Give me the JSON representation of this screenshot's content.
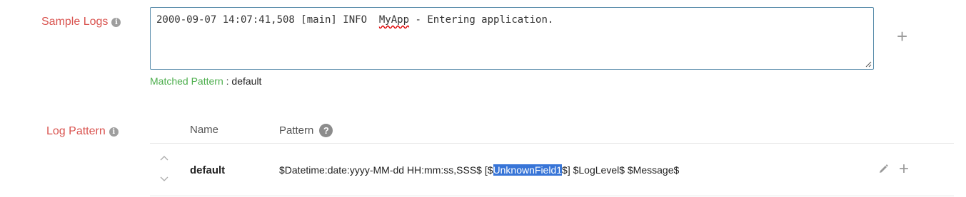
{
  "sample_logs": {
    "label": "Sample Logs",
    "log_prefix": "2000-09-07 14:07:41,508 [main] INFO  ",
    "log_misspelled": "MyApp",
    "log_suffix": " - Entering application.",
    "add_icon": "plus-icon"
  },
  "matched_pattern": {
    "label": "Matched Pattern",
    "separator": " : ",
    "value": "default"
  },
  "log_pattern": {
    "label": "Log Pattern",
    "columns": {
      "name": "Name",
      "pattern": "Pattern"
    },
    "help_glyph": "?",
    "rows": [
      {
        "name": "default",
        "pattern_before": "$Datetime:date:yyyy-MM-dd HH:mm:ss,SSS$ [$",
        "pattern_highlight": "UnknownField1",
        "pattern_after": "$] $LogLevel$ $Message$"
      }
    ]
  },
  "colors": {
    "label": "#d9534f",
    "matched_label": "#4cae4c",
    "highlight": "#3875d7",
    "textarea_border": "#5a8dab"
  }
}
